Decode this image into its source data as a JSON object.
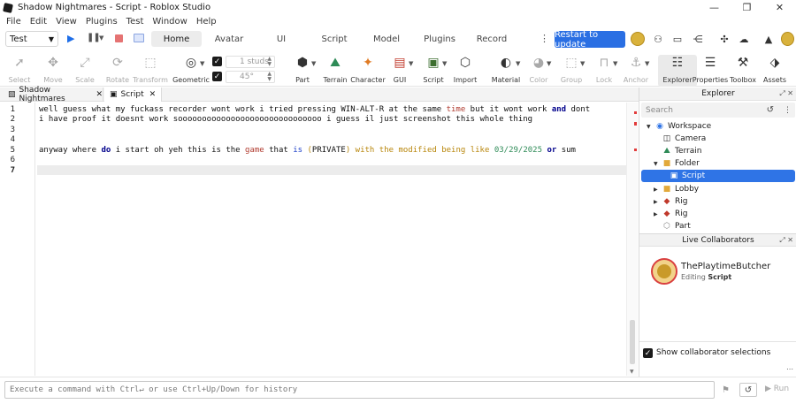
{
  "window": {
    "title": "Shadow Nightmares - Script - Roblox Studio",
    "controls": {
      "minimize": "—",
      "restore": "❐",
      "close": "✕"
    }
  },
  "menu": [
    "File",
    "Edit",
    "View",
    "Plugins",
    "Test",
    "Window",
    "Help"
  ],
  "top_bar": {
    "mode_select": "Test",
    "ribbon_tabs": [
      "Home",
      "Avatar",
      "UI",
      "Script",
      "Model",
      "Plugins",
      "Record"
    ],
    "active_tab": "Home",
    "update_button": "Restart to update"
  },
  "toolbar": {
    "tools": [
      {
        "name": "select",
        "label": "Select",
        "icon": "cursor-icon"
      },
      {
        "name": "move",
        "label": "Move",
        "icon": "move-icon"
      },
      {
        "name": "scale",
        "label": "Scale",
        "icon": "scale-icon"
      },
      {
        "name": "rotate",
        "label": "Rotate",
        "icon": "rotate-icon"
      },
      {
        "name": "transform",
        "label": "Transform",
        "icon": "transform-icon"
      },
      {
        "name": "geometric",
        "label": "Geometric",
        "icon": "geometric-icon"
      },
      {
        "name": "part",
        "label": "Part",
        "icon": "part-icon"
      },
      {
        "name": "terrain",
        "label": "Terrain",
        "icon": "terrain-icon"
      },
      {
        "name": "character",
        "label": "Character",
        "icon": "character-icon"
      },
      {
        "name": "gui",
        "label": "GUI",
        "icon": "gui-icon"
      },
      {
        "name": "script",
        "label": "Script",
        "icon": "script-icon"
      },
      {
        "name": "import",
        "label": "Import",
        "icon": "import-icon"
      },
      {
        "name": "material",
        "label": "Material",
        "icon": "material-icon"
      },
      {
        "name": "color",
        "label": "Color",
        "icon": "color-icon"
      },
      {
        "name": "group",
        "label": "Group",
        "icon": "group-icon"
      },
      {
        "name": "lock",
        "label": "Lock",
        "icon": "lock-icon"
      },
      {
        "name": "anchor",
        "label": "Anchor",
        "icon": "anchor-icon"
      },
      {
        "name": "explorer",
        "label": "Explorer",
        "icon": "explorer-icon"
      },
      {
        "name": "properties",
        "label": "Properties",
        "icon": "properties-icon"
      },
      {
        "name": "toolbox",
        "label": "Toolbox",
        "icon": "toolbox-icon"
      },
      {
        "name": "assets",
        "label": "Assets",
        "icon": "assets-icon"
      }
    ],
    "move_snap": "1 studs",
    "rotate_snap": "45°"
  },
  "doc_tabs": [
    {
      "label": "Shadow Nightmares",
      "icon": "place-icon"
    },
    {
      "label": "Script",
      "icon": "script-icon",
      "active": true
    }
  ],
  "editor": {
    "line_numbers": [
      "1",
      "2",
      "3",
      "4",
      "5",
      "6",
      "7"
    ],
    "lines": {
      "l1": {
        "a": "well guess what my fuckass recorder wont work i tried pressing WIN-ALT-R at the same ",
        "b": "time",
        "c": " but it wont work ",
        "d": "and",
        "e": " dont"
      },
      "l2": "i have proof it doesnt work soooooooooooooooooooooooooooooo i guess il just screenshot this whole thing",
      "l5": {
        "a": "anyway where ",
        "b": "do",
        "c": " i start oh yeh this is the ",
        "d": "game",
        "e": " that ",
        "f": "is",
        "g": " (",
        "h": "PRIVATE",
        "i": ") with the modified being like ",
        "j": "03/29/2025",
        "k": " ",
        "l": "or",
        "m": " sum"
      }
    }
  },
  "command_bar": {
    "placeholder": "Execute a command with Ctrl↵ or use Ctrl+Up/Down for history",
    "run_label": "Run"
  },
  "explorer": {
    "header": "Explorer",
    "search_placeholder": "Search",
    "items": [
      {
        "label": "Workspace",
        "icon": "workspace-icon",
        "expanded": true
      },
      {
        "label": "Camera",
        "icon": "camera-icon"
      },
      {
        "label": "Terrain",
        "icon": "terrain-icon"
      },
      {
        "label": "Folder",
        "icon": "folder-icon",
        "expanded": true
      },
      {
        "label": "Script",
        "icon": "script-icon",
        "selected": true
      },
      {
        "label": "Lobby",
        "icon": "folder-icon"
      },
      {
        "label": "Rig",
        "icon": "model-icon"
      },
      {
        "label": "Rig",
        "icon": "model-icon"
      },
      {
        "label": "Part",
        "icon": "part-icon"
      }
    ]
  },
  "collaborators": {
    "header": "Live Collaborators",
    "user_name": "ThePlaytimeButcher",
    "status_prefix": "Editing",
    "status_target": "Script",
    "show_selections_label": "Show collaborator selections"
  },
  "colors": {
    "accent": "#2a6fe3",
    "selected_row": "#2f74e6",
    "keyword": "#00008b",
    "builtin": "#b03a2e",
    "number": "#2e8b57",
    "error_marker": "#e23b3b"
  }
}
